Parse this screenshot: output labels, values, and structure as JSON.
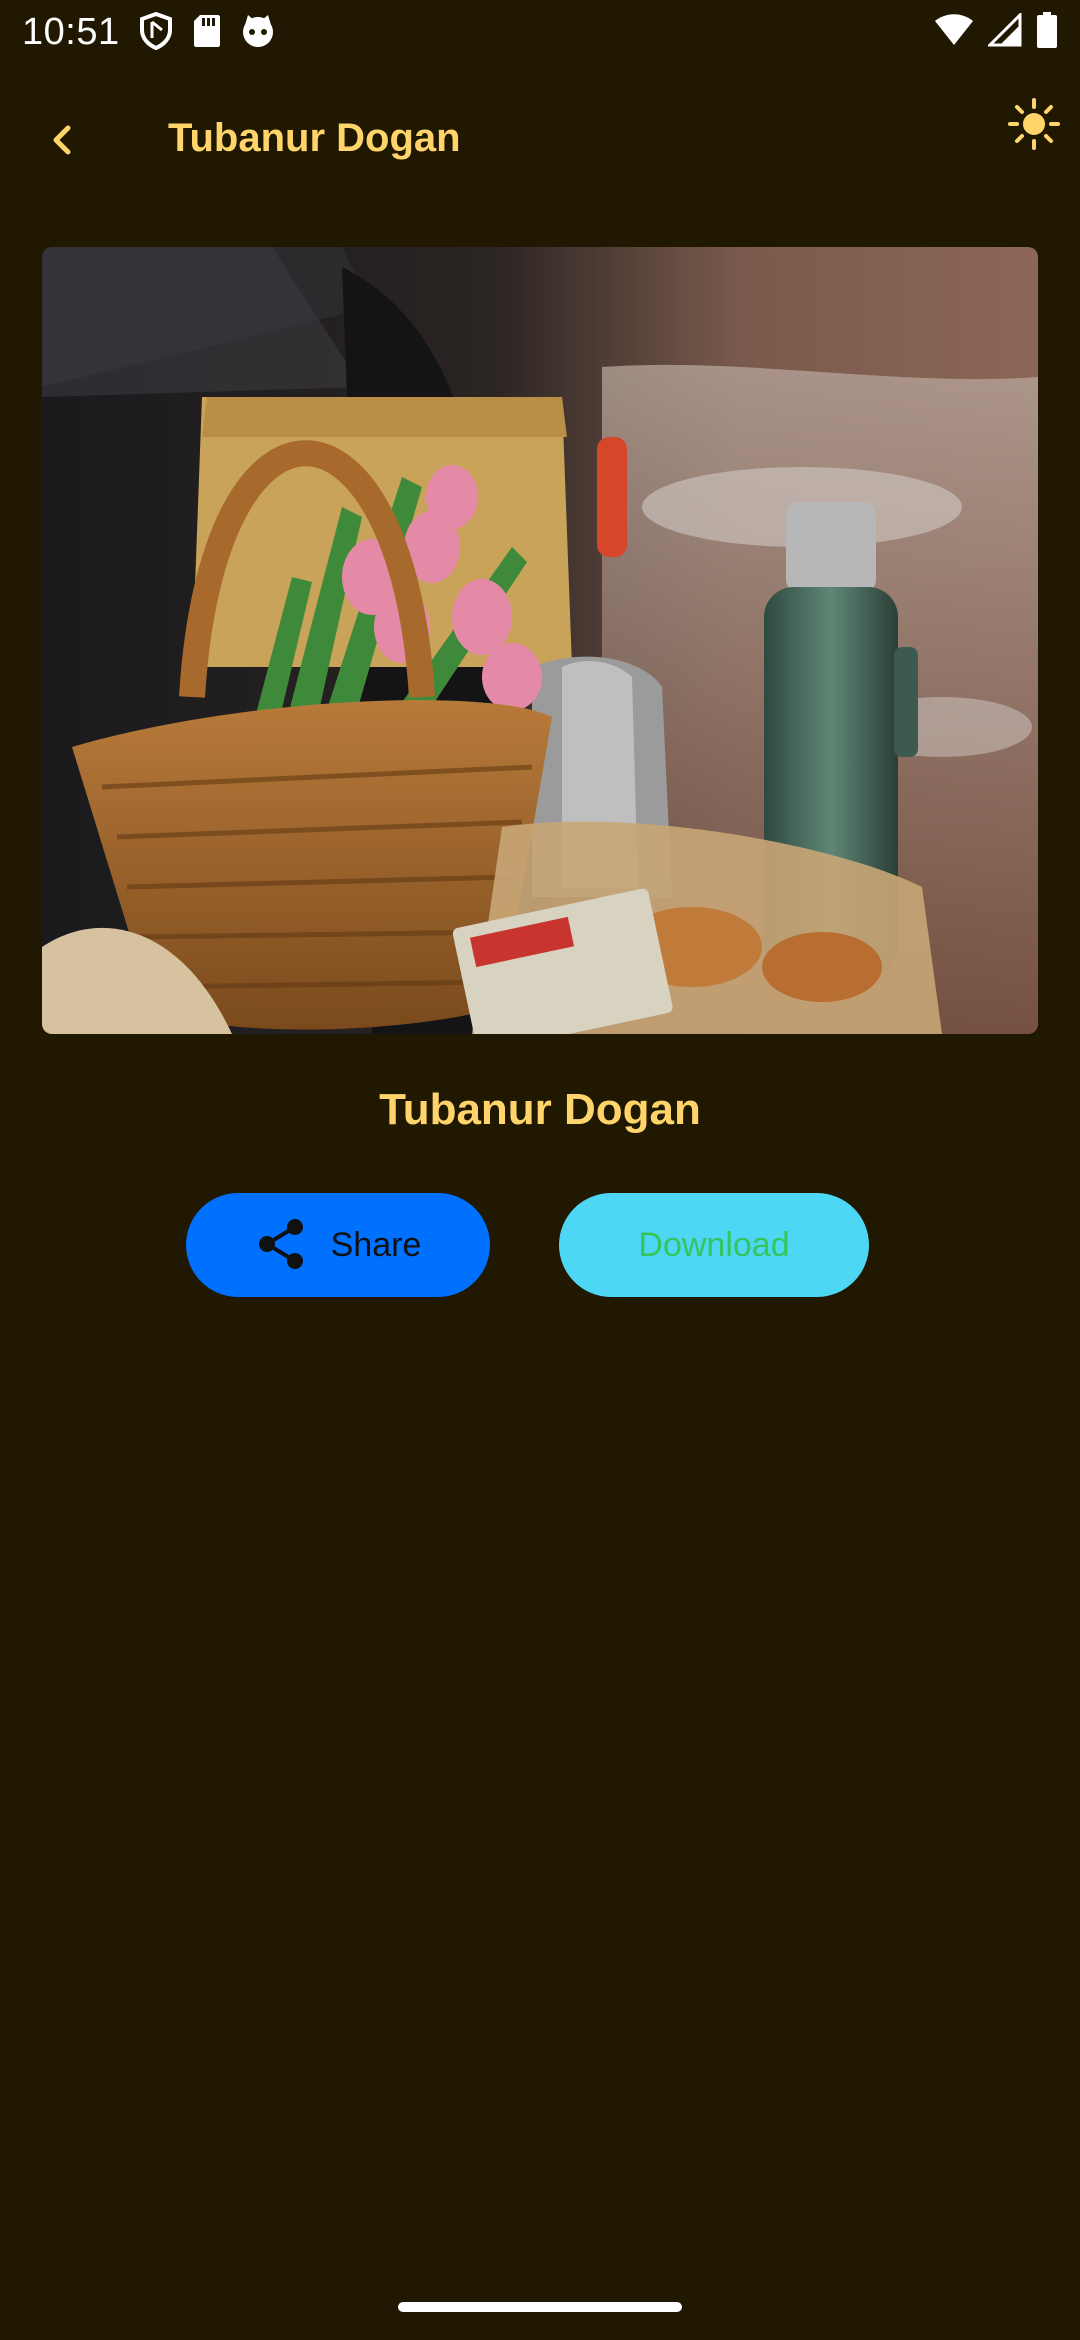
{
  "status_bar": {
    "time": "10:51",
    "icons_left": [
      "shield-icon",
      "sd-card-icon",
      "cat-face-icon"
    ],
    "icons_right": [
      "wifi-icon",
      "cellular-signal-icon",
      "battery-icon"
    ]
  },
  "app_bar": {
    "title": "Tubanur Dogan",
    "back_icon": "chevron-left-icon",
    "theme_icon": "sun-icon"
  },
  "photo": {
    "subject": "picnic basket with pink tulips, thermos, and pastries in a car trunk"
  },
  "author": {
    "name": "Tubanur Dogan"
  },
  "actions": {
    "share_label": "Share",
    "share_icon": "share-icon",
    "download_label": "Download"
  },
  "colors": {
    "background": "#201800",
    "accent_text": "#ffd56b",
    "share_button": "#0070ff",
    "download_button": "#4dd7f5",
    "download_text": "#35c55d"
  }
}
